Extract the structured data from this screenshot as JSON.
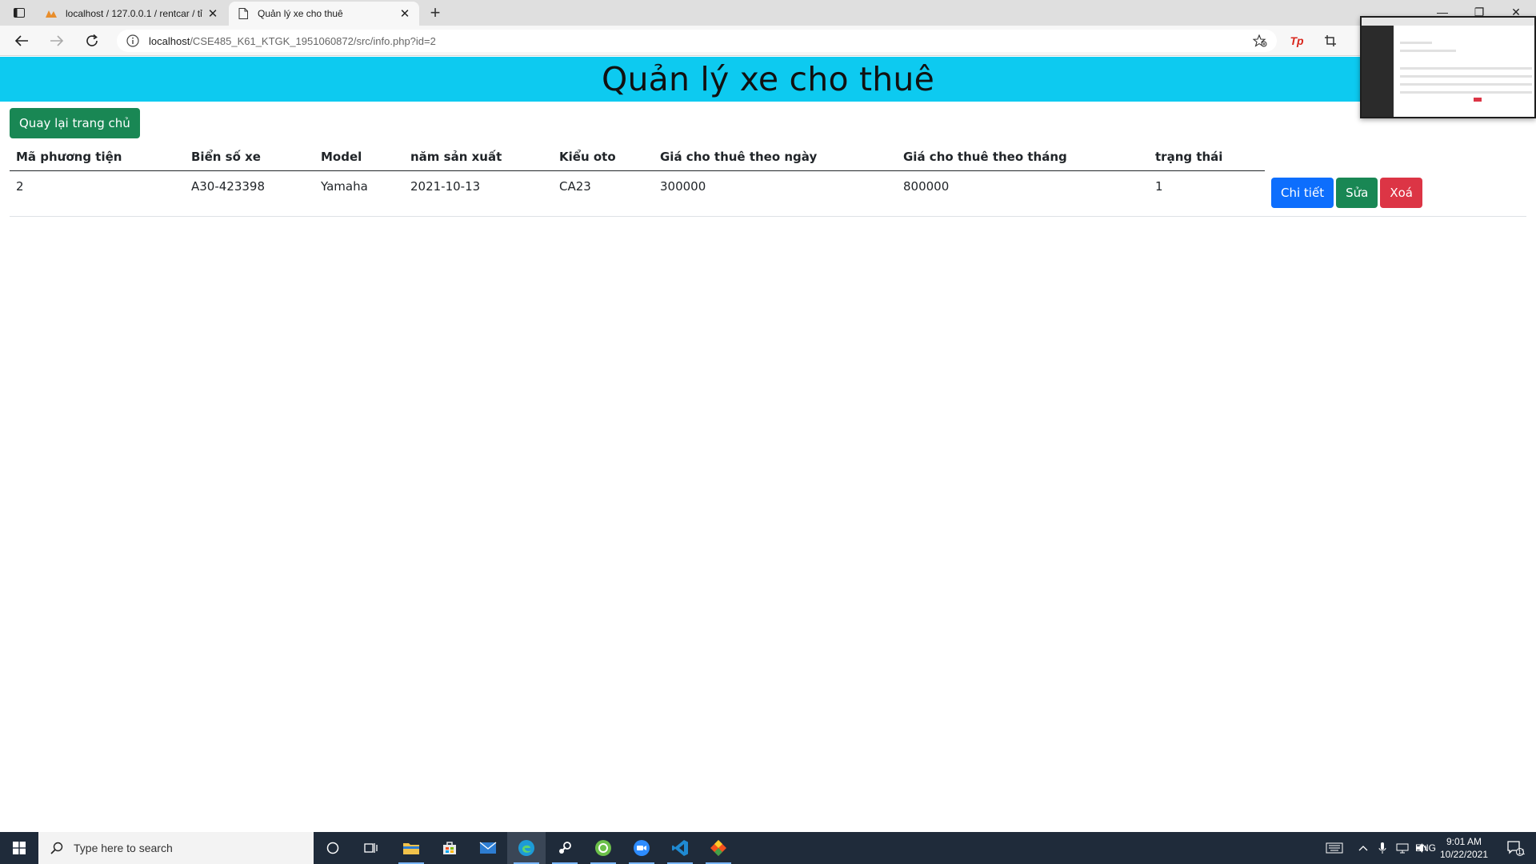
{
  "browser": {
    "tabs": [
      {
        "title": "localhost / 127.0.0.1 / rentcar / tỉ",
        "active": false
      },
      {
        "title": "Quản lý xe cho thuê",
        "active": true
      }
    ],
    "url_host": "localhost",
    "url_path": "/CSE485_K61_KTGK_1951060872/src/info.php?id=2",
    "extension_label": "Tp"
  },
  "page": {
    "banner_title": "Quản lý xe cho thuê",
    "back_home_label": "Quay lại trang chủ",
    "table": {
      "headers": [
        "Mã phương tiện",
        "Biển số xe",
        "Model",
        "năm sản xuất",
        "Kiểu oto",
        "Giá cho thuê theo ngày",
        "Giá cho thuê theo tháng",
        "trạng thái"
      ],
      "rows": [
        [
          "2",
          "A30-423398",
          "Yamaha",
          "2021-10-13",
          "CA23",
          "300000",
          "800000",
          "1"
        ]
      ],
      "actions": {
        "detail": "Chi tiết",
        "edit": "Sửa",
        "delete": "Xoá"
      }
    }
  },
  "taskbar": {
    "search_placeholder": "Type here to search",
    "language": "ENG",
    "time": "9:01 AM",
    "date": "10/22/2021",
    "notification_count": "11"
  },
  "colors": {
    "banner": "#0dcaf0",
    "primary": "#0d6efd",
    "success": "#198754",
    "danger": "#dc3545",
    "taskbar": "#1f2b3a"
  }
}
